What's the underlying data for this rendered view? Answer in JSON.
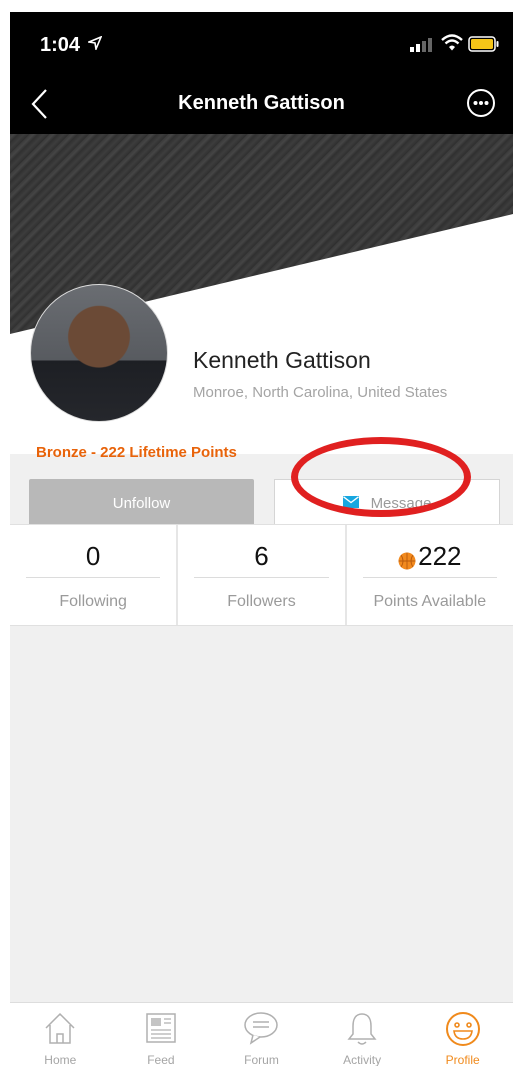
{
  "status_bar": {
    "time": "1:04"
  },
  "nav": {
    "title": "Kenneth Gattison"
  },
  "profile": {
    "name": "Kenneth Gattison",
    "location": "Monroe, North Carolina, United States",
    "points_line": "Bronze - 222 Lifetime Points"
  },
  "actions": {
    "unfollow_label": "Unfollow",
    "message_label": "Message"
  },
  "stats": [
    {
      "value": "0",
      "label": "Following"
    },
    {
      "value": "6",
      "label": "Followers"
    },
    {
      "value": "222",
      "label": "Points Available"
    }
  ],
  "tabs": [
    {
      "label": "Home",
      "icon": "home-icon"
    },
    {
      "label": "Feed",
      "icon": "feed-icon"
    },
    {
      "label": "Forum",
      "icon": "forum-icon"
    },
    {
      "label": "Activity",
      "icon": "bell-icon"
    },
    {
      "label": "Profile",
      "icon": "smiley-icon"
    }
  ],
  "colors": {
    "accent": "#e8630a",
    "highlight": "#e02020",
    "tab_active": "#f08a1c",
    "mail": "#18a7e0"
  }
}
